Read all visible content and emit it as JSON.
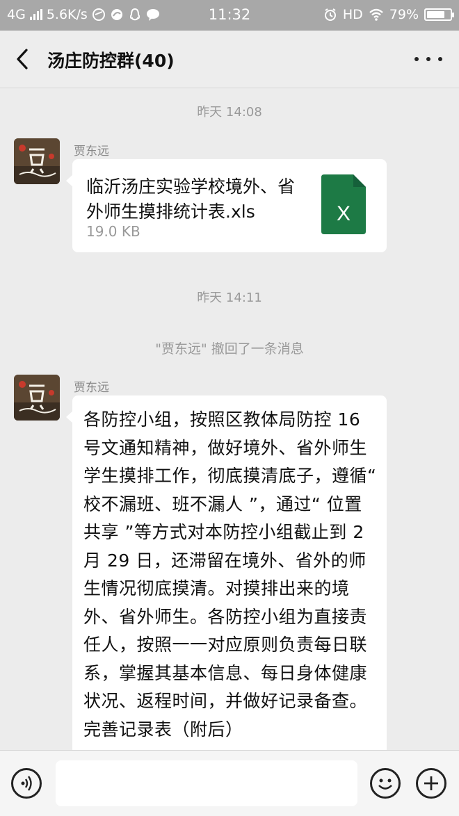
{
  "status_bar": {
    "network": "4G",
    "speed": "5.6K/s",
    "time": "11:32",
    "hd": "HD",
    "battery": "79%",
    "battery_level": 0.79
  },
  "nav": {
    "title": "汤庄防控群(40)",
    "back_icon": "chevron-left-icon",
    "more_icon": "more-dots-icon"
  },
  "chat": {
    "timestamp_1": "昨天 14:08",
    "file_message": {
      "sender": "贾东远",
      "file_name": "临沂汤庄实验学校境外、省外师生摸排统计表.xls",
      "file_size": "19.0 KB",
      "file_icon": "excel-file-icon",
      "icon_letter": "X",
      "icon_color": "#1d7a45"
    },
    "timestamp_2": "昨天 14:11",
    "recall_notice": "\"贾东远\" 撤回了一条消息",
    "text_message": {
      "sender": "贾东远",
      "text": "各防控小组，按照区教体局防控 16 号文通知精神，做好境外、省外师生学生摸排工作，彻底摸清底子，遵循“ 校不漏班、班不漏人 ”，通过“ 位置共享 ”等方式对本防控小组截止到 2 月 29 日，还滞留在境外、省外的师生情况彻底摸清。对摸排出来的境外、省外师生。各防控小组为直接责任人，按照一一对应原则负责每日联系，掌握其基本信息、每日身体健康状况、返程时间，并做好记录备查。完善记录表（附后）"
    }
  },
  "input_bar": {
    "voice_icon": "voice-icon",
    "emoji_icon": "emoji-icon",
    "plus_icon": "plus-icon"
  }
}
